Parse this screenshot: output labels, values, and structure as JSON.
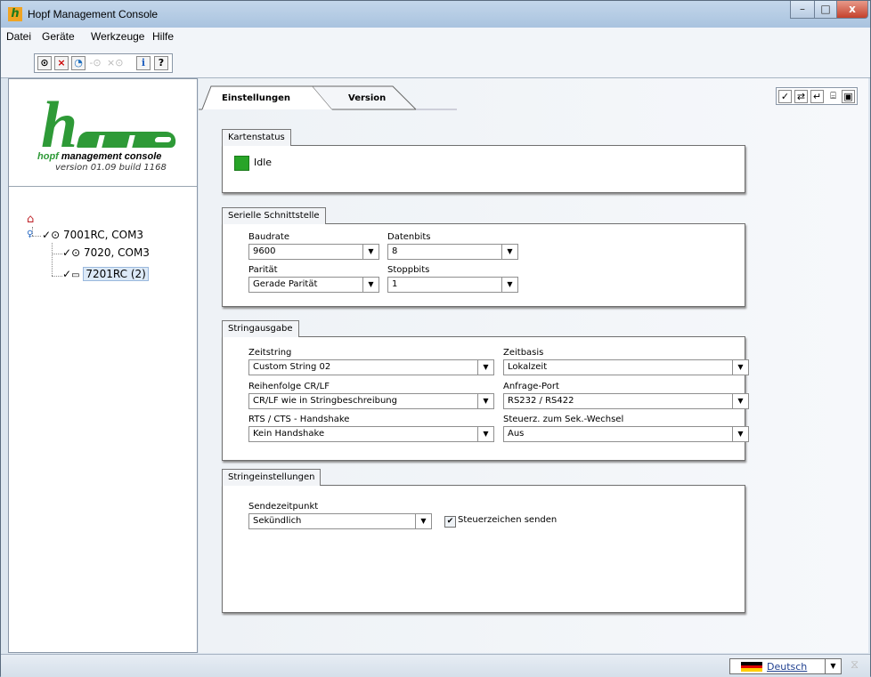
{
  "window": {
    "title": "Hopf Management Console",
    "controls": {
      "minimize": "–",
      "maximize": "□",
      "close": "x"
    }
  },
  "menu": [
    "Datei",
    "Geräte",
    "Werkzeuge",
    "Hilfe"
  ],
  "toolbar": [
    {
      "icon": "clock-icon",
      "glyph": "⊙",
      "enabled": true
    },
    {
      "icon": "delete-icon",
      "glyph": "×",
      "enabled": true,
      "color": "#cc0000"
    },
    {
      "icon": "refresh-icon",
      "glyph": "◔",
      "enabled": true,
      "color": "#1f6fbf"
    },
    {
      "icon": "connect-icon",
      "glyph": "-⊙",
      "enabled": false
    },
    {
      "icon": "disconnect-icon",
      "glyph": "×⊙",
      "enabled": false
    },
    {
      "icon": "info-icon",
      "glyph": "i",
      "enabled": true,
      "color": "#1f5fbf"
    },
    {
      "icon": "help-icon",
      "glyph": "?",
      "enabled": true
    }
  ],
  "logo": {
    "letters": "hmc",
    "brand": "hopf",
    "tagline": "management console",
    "version": "version 01.09 build 1168"
  },
  "tree": [
    {
      "label": "7001RC, COM3",
      "level": 1
    },
    {
      "label": "7020, COM3",
      "level": 2
    },
    {
      "label": "7201RC (2)",
      "level": 2,
      "selected": true
    }
  ],
  "tabs": [
    {
      "label": "Einstellungen",
      "active": true
    },
    {
      "label": "Version",
      "active": false
    }
  ],
  "actions": [
    "apply-icon",
    "sync-icon",
    "undo-icon",
    "open-icon",
    "save-icon"
  ],
  "kartenstatus": {
    "legend": "Kartenstatus",
    "status": "Idle",
    "status_color": "#28a428"
  },
  "seriell": {
    "legend": "Serielle Schnittstelle",
    "baudrate_label": "Baudrate",
    "baudrate": "9600",
    "datenbits_label": "Datenbits",
    "datenbits": "8",
    "paritaet_label": "Parität",
    "paritaet": "Gerade Parität",
    "stoppbits_label": "Stoppbits",
    "stoppbits": "1"
  },
  "stringausgabe": {
    "legend": "Stringausgabe",
    "zeitstring_label": "Zeitstring",
    "zeitstring": "Custom String 02",
    "zeitbasis_label": "Zeitbasis",
    "zeitbasis": "Lokalzeit",
    "crlf_label": "Reihenfolge CR/LF",
    "crlf": "CR/LF wie in Stringbeschreibung",
    "port_label": "Anfrage-Port",
    "port": "RS232 / RS422",
    "rts_label": "RTS / CTS - Handshake",
    "rts": "Kein Handshake",
    "steuerz_label": "Steuerz. zum Sek.-Wechsel",
    "steuerz": "Aus"
  },
  "stringeinstellungen": {
    "legend": "Stringeinstellungen",
    "sendezeit_label": "Sendezeitpunkt",
    "sendezeit": "Sekündlich",
    "steuerzeichen_label": "Steuerzeichen senden",
    "steuerzeichen_checked": true
  },
  "statusbar": {
    "language": "Deutsch",
    "busy_icon": "hourglass-icon"
  }
}
